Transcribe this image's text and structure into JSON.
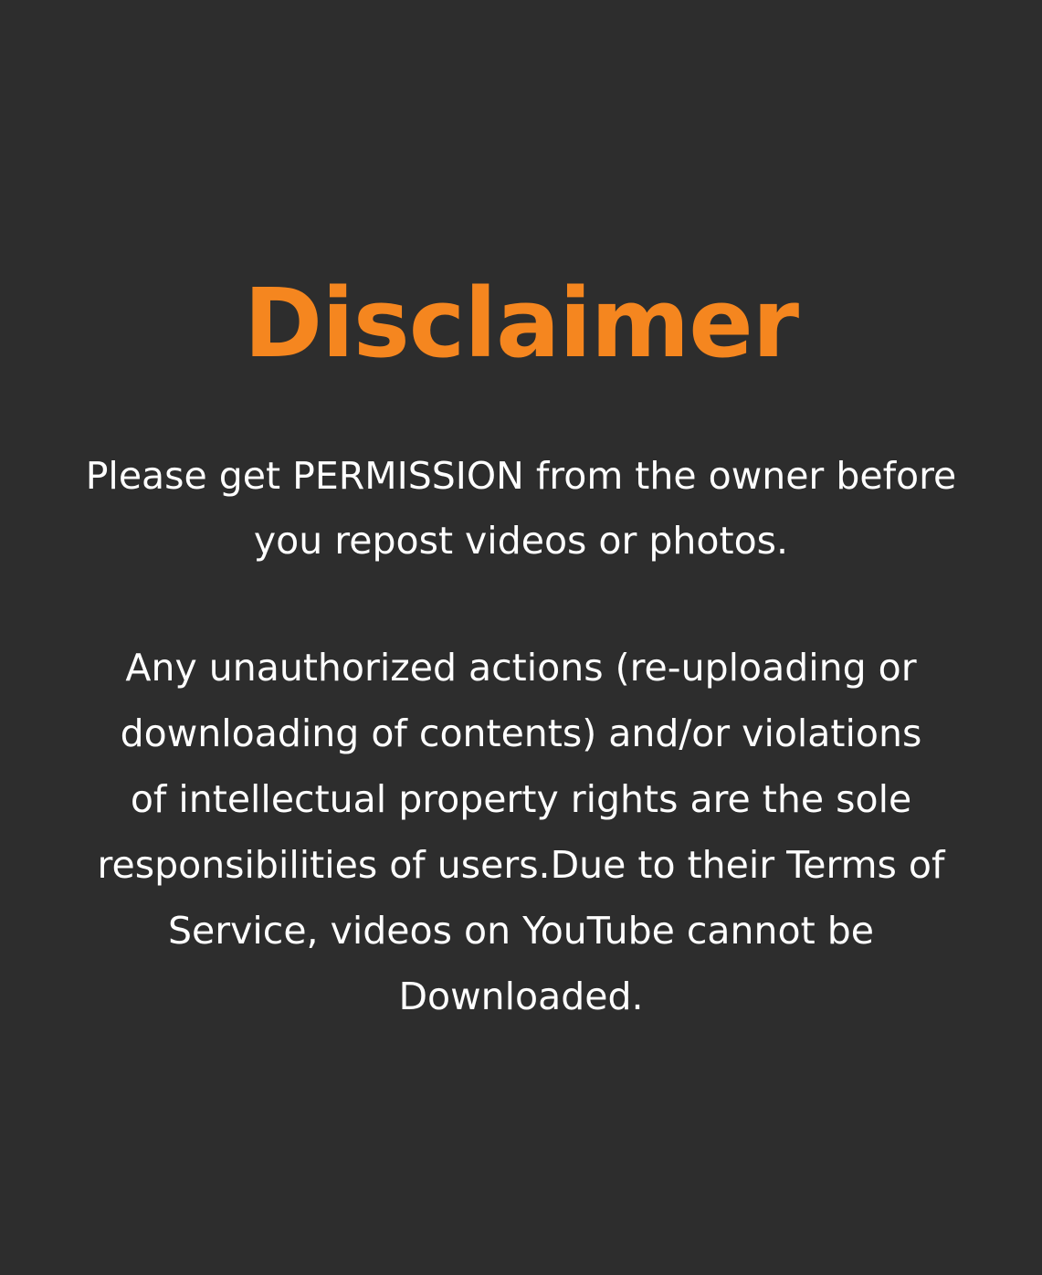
{
  "disclaimer": {
    "title": "Disclaimer",
    "intro_lines": [
      "Please get PERMISSION from the owner before",
      "you repost videos or photos."
    ],
    "body_lines": [
      "Any unauthorized actions (re-uploading or",
      "downloading of contents) and/or violations",
      "of intellectual property rights are the sole",
      "responsibilities of users.Due to their Terms of",
      "Service, videos on YouTube cannot be",
      "Downloaded."
    ]
  },
  "colors": {
    "background": "#2d2d2d",
    "accent": "#f5861f",
    "text": "#ffffff"
  }
}
